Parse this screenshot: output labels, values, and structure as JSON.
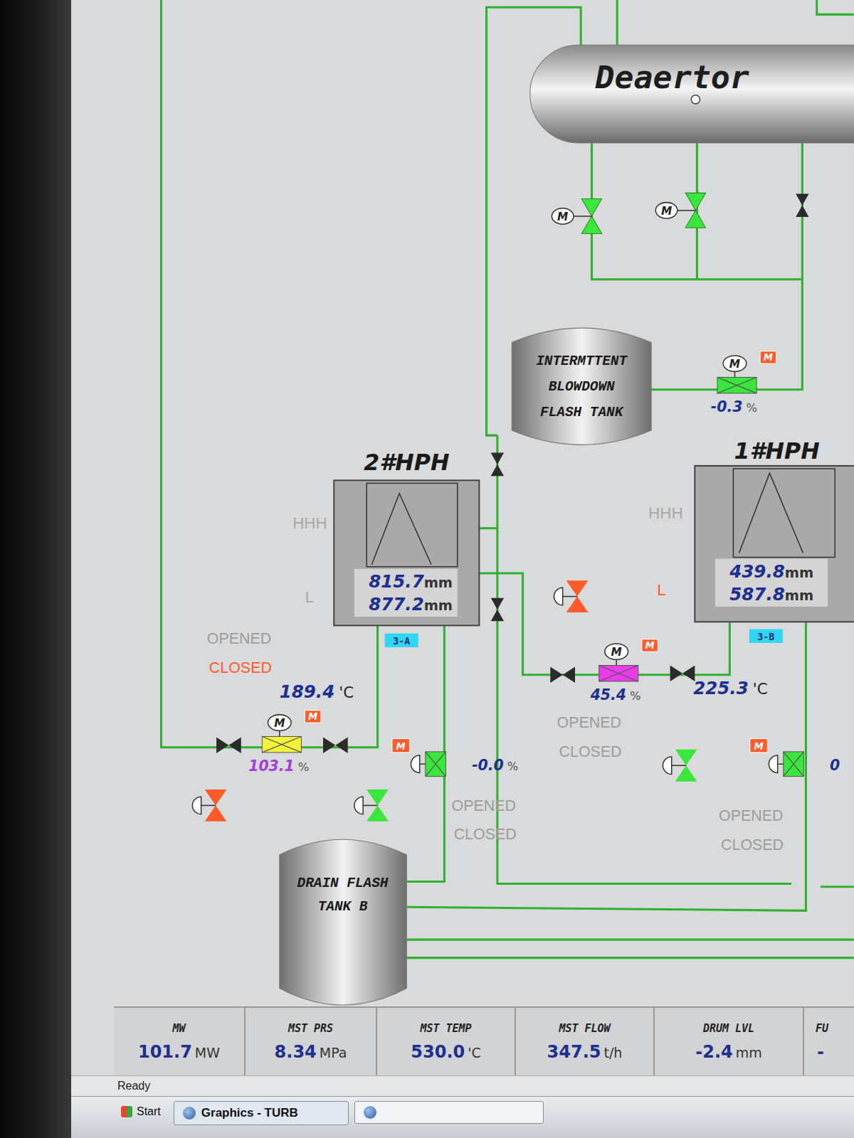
{
  "screen": {
    "motor_glyph": "M",
    "badge_glyph": "M",
    "vessels": {
      "deaerator": {
        "label": "Deaertor"
      },
      "blowdown_tank": {
        "lines": [
          "INTERMTTENT",
          "BLOWDOWN",
          "FLASH TANK"
        ]
      },
      "drain_tank": {
        "lines": [
          "DRAIN FLASH",
          "TANK B"
        ]
      }
    },
    "heaters": [
      {
        "label": "2#HPH",
        "alarm_high": "HHH",
        "alarm_low": "L",
        "alarm_low_active": false,
        "levels": [
          {
            "value": "815.7",
            "unit": "mm"
          },
          {
            "value": "877.2",
            "unit": "mm"
          }
        ],
        "tag": "3-A"
      },
      {
        "label": "1#HPH",
        "alarm_high": "HHH",
        "alarm_low": "L",
        "alarm_low_active": true,
        "levels": [
          {
            "value": "439.8",
            "unit": "mm"
          },
          {
            "value": "587.8",
            "unit": "mm"
          }
        ],
        "tag": "3-B"
      }
    ],
    "valves": [
      {
        "kind": "motor-v",
        "color": "#39e639"
      },
      {
        "kind": "motor-v",
        "color": "#39e639"
      },
      {
        "kind": "gate-v",
        "color": "#2b2b2b"
      },
      {
        "kind": "motor-box",
        "color": "#39e639",
        "badge": true,
        "reading": "-0.3",
        "unit": "%",
        "highlight": false
      },
      {
        "kind": "gate-v",
        "color": "#2b2b2b"
      },
      {
        "kind": "gate-v",
        "color": "#2b2b2b"
      },
      {
        "kind": "gate-h",
        "color": "#2b2b2b"
      },
      {
        "kind": "motor-box",
        "color": "#e83ce8",
        "badge": true,
        "reading": "45.4",
        "unit": "%",
        "highlight": false
      },
      {
        "kind": "gate-h",
        "color": "#2b2b2b"
      },
      {
        "kind": "gate-h",
        "color": "#2b2b2b"
      },
      {
        "kind": "motor-box",
        "color": "#f2f23a",
        "badge": true,
        "reading": "103.1",
        "unit": "%",
        "highlight": true
      },
      {
        "kind": "gate-h",
        "color": "#2b2b2b"
      },
      {
        "kind": "pneumatic",
        "color": "#ff5a2a"
      },
      {
        "kind": "pneumatic",
        "color": "#39e639"
      },
      {
        "kind": "pneumatic-box",
        "color": "#39e639",
        "badge": true,
        "reading": "-0.0",
        "unit": "%",
        "highlight": false
      },
      {
        "kind": "pneumatic",
        "color": "#ff5a2a"
      },
      {
        "kind": "pneumatic",
        "color": "#39e639"
      },
      {
        "kind": "pneumatic-box",
        "color": "#39e639",
        "badge": true,
        "reading": "0",
        "unit": "",
        "highlight": false
      }
    ],
    "temperatures": [
      {
        "value": "189.4",
        "unit": "'C"
      },
      {
        "value": "225.3",
        "unit": "'C"
      }
    ],
    "position_indicators": [
      {
        "opened": "OPENED",
        "closed": "CLOSED",
        "opened_active": false,
        "closed_active": true
      },
      {
        "opened": "OPENED",
        "closed": "CLOSED",
        "opened_active": false,
        "closed_active": false
      },
      {
        "opened": "OPENED",
        "closed": "CLOSED",
        "opened_active": false,
        "closed_active": false
      },
      {
        "opened": "OPENED",
        "closed": "CLOSED",
        "opened_active": false,
        "closed_active": false
      }
    ]
  },
  "status_bar": [
    {
      "label": "MW",
      "value": "101.7",
      "unit": "MW"
    },
    {
      "label": "MST PRS",
      "value": "8.34",
      "unit": "MPa"
    },
    {
      "label": "MST TEMP",
      "value": "530.0",
      "unit": "'C"
    },
    {
      "label": "MST FLOW",
      "value": "347.5",
      "unit": "t/h"
    },
    {
      "label": "DRUM LVL",
      "value": "-2.4",
      "unit": "mm"
    },
    {
      "label": "FU",
      "value": "-",
      "unit": ""
    }
  ],
  "footer": {
    "status": "Ready"
  },
  "taskbar": {
    "start": "Start",
    "tasks": [
      {
        "label": "Graphics - TURB",
        "selected": true
      }
    ]
  }
}
